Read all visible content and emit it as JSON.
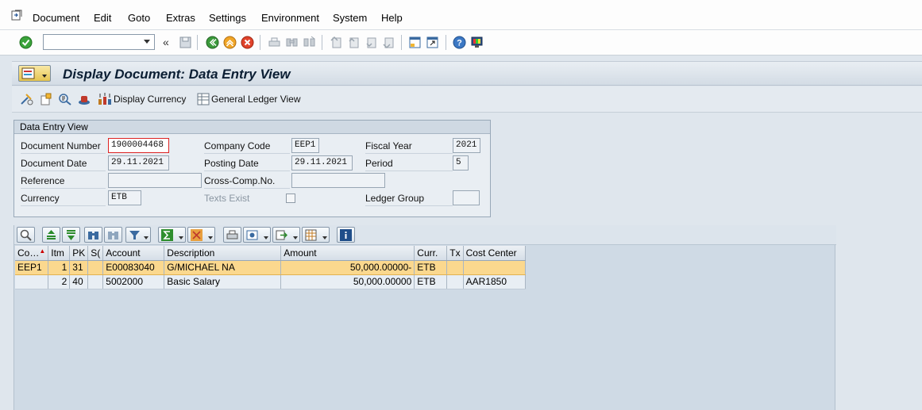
{
  "menu": {
    "items": [
      {
        "label": "Document",
        "key": "D",
        "rest": "ocument"
      },
      {
        "label": "Edit",
        "key": "E",
        "rest": "dit"
      },
      {
        "label": "Goto",
        "key": "G",
        "rest": "oto"
      },
      {
        "label": "Extras",
        "key": "E",
        "rest": "xtras",
        "pre": "Extr",
        "key2": "a",
        "rest2": "s"
      },
      {
        "label": "Settings",
        "key": "S",
        "rest": "ettings"
      },
      {
        "label": "Environment",
        "key": "n",
        "rest": "vironment"
      },
      {
        "label": "System",
        "key": "y",
        "rest": "stem"
      },
      {
        "label": "Help",
        "key": "H",
        "rest": "elp"
      }
    ]
  },
  "systoolbar": {
    "okcode_value": ""
  },
  "title": "Display Document: Data Entry View",
  "apptoolbar": {
    "display_currency": "Display Currency",
    "general_ledger_view": "General Ledger View"
  },
  "frame": {
    "title": "Data Entry View",
    "labels": {
      "doc_number": "Document Number",
      "company_code": "Company Code",
      "fiscal_year": "Fiscal Year",
      "doc_date": "Document Date",
      "posting_date": "Posting Date",
      "period": "Period",
      "reference": "Reference",
      "cross_comp": "Cross-Comp.No.",
      "currency": "Currency",
      "texts_exist": "Texts Exist",
      "ledger_group": "Ledger Group"
    },
    "values": {
      "doc_number": "1900004468",
      "company_code": "EEP1",
      "fiscal_year": "2021",
      "doc_date": "29.11.2021",
      "posting_date": "29.11.2021",
      "period": "5",
      "reference": "",
      "cross_comp": "",
      "currency": "ETB",
      "ledger_group": ""
    }
  },
  "grid": {
    "columns": [
      "Co…",
      "Itm",
      "PK",
      "S(",
      "Account",
      "Description",
      "Amount",
      "Curr.",
      "Tx",
      "Cost Center"
    ],
    "rows": [
      [
        "EEP1",
        "1",
        "31",
        "",
        "E00083040",
        "G/MICHAEL NA",
        "50,000.00000-",
        "ETB",
        "",
        ""
      ],
      [
        "",
        "2",
        "40",
        "",
        "5002000",
        "Basic Salary",
        "50,000.00000",
        "ETB",
        "",
        "AAR1850"
      ]
    ]
  },
  "colors": {
    "title_bar": "#d3dce5",
    "selected_row": "#fbd88e",
    "panel_bg": "#cfdae5"
  }
}
